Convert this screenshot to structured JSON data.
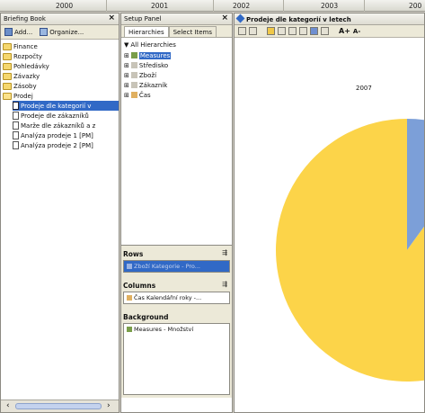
{
  "timeline": {
    "years": [
      "2000",
      "2001",
      "2002",
      "2003",
      "200"
    ]
  },
  "briefing_book": {
    "title": "Briefing Book",
    "close": "×",
    "add_label": "Add...",
    "organize_label": "Organize...",
    "folders": [
      "Finance",
      "Rozpočty",
      "Pohledávky",
      "Závazky",
      "Zásoby",
      "Prodej"
    ],
    "items": [
      "Prodeje dle kategorií v",
      "Prodeje dle zákazníků",
      "Marže dle zákazníků a z",
      "Analýza prodeje 1 [PM]",
      "Analýza prodeje 2 [PM]"
    ],
    "scroll_left": "‹",
    "scroll_right": "›"
  },
  "setup_panel": {
    "title": "Setup Panel",
    "close": "×",
    "tabs": [
      "Hierarchies",
      "Select Items"
    ],
    "all_hierarchies": "All Hierarchies",
    "tree": [
      "Measures",
      "Středisko",
      "Zboží",
      "Zákazník",
      "Čas"
    ],
    "rows_label": "Rows",
    "rows_value": "Zboží Kategorie - Pro...",
    "columns_label": "Columns",
    "columns_value": "Čas Kalendářní roky -...",
    "background_label": "Background",
    "background_value": "Measures - Množství"
  },
  "chart": {
    "title": "Prodeje dle kategorií v letech",
    "font_up": "A+",
    "font_down": "A-",
    "year_label": "2007",
    "colors": {
      "major": "#fcd449",
      "minor": "#7c9fd8"
    }
  },
  "chart_data": {
    "type": "pie",
    "title": "2007",
    "slices": [
      {
        "value": 90
      },
      {
        "value": 10
      }
    ]
  }
}
